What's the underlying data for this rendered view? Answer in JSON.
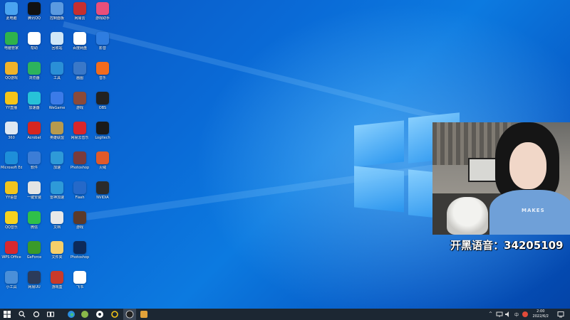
{
  "desktop": {
    "icons": [
      {
        "label": "此电脑",
        "color": "#4aa3f0",
        "icon": "computer-icon"
      },
      {
        "label": "腾讯QQ",
        "color": "#111111",
        "icon": "qq-penguin-icon"
      },
      {
        "label": "控制面板",
        "color": "#5b9ae0",
        "icon": "control-panel-icon"
      },
      {
        "label": "网易云",
        "color": "#c62f2f",
        "icon": "game-app-icon"
      },
      {
        "label": "游戏助手",
        "color": "#e84f7a",
        "icon": "gamepad-icon"
      },
      {
        "label": "电脑管家",
        "color": "#2fb24c",
        "icon": "shield-plus-icon"
      },
      {
        "label": "帮助",
        "color": "#ffffff",
        "icon": "help-icon"
      },
      {
        "label": "回收站",
        "color": "#cfe6f7",
        "icon": "recycle-bin-icon"
      },
      {
        "label": "百度网盘",
        "color": "#ffffff",
        "icon": "cloud-disk-icon"
      },
      {
        "label": "影音",
        "color": "#2f7de0",
        "icon": "media-icon"
      },
      {
        "label": "QQ游戏",
        "color": "#f0b32a",
        "icon": "qq-game-icon"
      },
      {
        "label": "浏览器",
        "color": "#2db35d",
        "icon": "browser-icon"
      },
      {
        "label": "工具",
        "color": "#2a8fd6",
        "icon": "tool-icon"
      },
      {
        "label": "画图",
        "color": "#3a78c8",
        "icon": "pen-icon"
      },
      {
        "label": "音乐",
        "color": "#f26b1d",
        "icon": "music-icon"
      },
      {
        "label": "YY直播",
        "color": "#f5c518",
        "icon": "yy-icon"
      },
      {
        "label": "加速器",
        "color": "#27c2d8",
        "icon": "accelerator-icon"
      },
      {
        "label": "WeGame",
        "color": "#3b7be8",
        "icon": "wegame-icon"
      },
      {
        "label": "游戏",
        "color": "#8a4a3a",
        "icon": "game-portrait-icon"
      },
      {
        "label": "OBS",
        "color": "#222222",
        "icon": "obs-icon"
      },
      {
        "label": "360",
        "color": "#dfe8f2",
        "icon": "monitor-icon"
      },
      {
        "label": "Acrobat",
        "color": "#d6261f",
        "icon": "acrobat-icon"
      },
      {
        "label": "英雄联盟",
        "color": "#b79a4e",
        "icon": "lol-icon"
      },
      {
        "label": "网易云音乐",
        "color": "#d9262b",
        "icon": "netease-music-icon"
      },
      {
        "label": "Logitech",
        "color": "#1a1a1a",
        "icon": "logitech-icon"
      },
      {
        "label": "Microsoft Edge",
        "color": "#1e8fd9",
        "icon": "edge-icon"
      },
      {
        "label": "软件",
        "color": "#3c7dd6",
        "icon": "app-icon"
      },
      {
        "label": "加速",
        "color": "#2e9ad8",
        "icon": "speed-icon"
      },
      {
        "label": "Photoshop",
        "color": "#7a3b3b",
        "icon": "photo-icon"
      },
      {
        "label": "火绒",
        "color": "#e05a2a",
        "icon": "security-icon"
      },
      {
        "label": "YY语音",
        "color": "#f2c51d",
        "icon": "owl-icon"
      },
      {
        "label": "一键安装",
        "color": "#e4e4e4",
        "icon": "installer-icon"
      },
      {
        "label": "雷神加速",
        "color": "#2e9ad8",
        "icon": "thunder-icon"
      },
      {
        "label": "Flash",
        "color": "#2569c9",
        "icon": "flash-icon"
      },
      {
        "label": "NVIDIA",
        "color": "#2b2b2b",
        "icon": "keyboard-icon"
      },
      {
        "label": "QQ音乐",
        "color": "#f5d21e",
        "icon": "qq-music-icon"
      },
      {
        "label": "微信",
        "color": "#2fc04a",
        "icon": "wechat-icon"
      },
      {
        "label": "文档",
        "color": "#e8e8e8",
        "icon": "document-icon"
      },
      {
        "label": "游戏",
        "color": "#5b3a2a",
        "icon": "game-cover-icon"
      },
      {
        "label": "WPS Office",
        "color": "#d7282f",
        "icon": "wps-icon"
      },
      {
        "label": "GeForce",
        "color": "#3a9a2a",
        "icon": "nvidia-icon"
      },
      {
        "label": "文件夹",
        "color": "#f5cf6a",
        "icon": "folder-icon"
      },
      {
        "label": "Photoshop",
        "color": "#0d2a5a",
        "icon": "ps-icon"
      },
      {
        "label": "小工具",
        "color": "#4b8fd8",
        "icon": "utility-icon"
      },
      {
        "label": "网易UU",
        "color": "#2b3b5a",
        "icon": "uu-icon"
      },
      {
        "label": "游戏盒",
        "color": "#c83a2a",
        "icon": "game-box-icon"
      },
      {
        "label": "飞书",
        "color": "#ffffff",
        "icon": "feishu-icon"
      }
    ]
  },
  "stream": {
    "overlay_text": "开黑语音：34205109",
    "shirt_text": "MAKES"
  },
  "taskbar": {
    "clock_time": "2:00",
    "clock_date": "2022/6/2",
    "ime_label": "中",
    "tray_caret": "^"
  }
}
